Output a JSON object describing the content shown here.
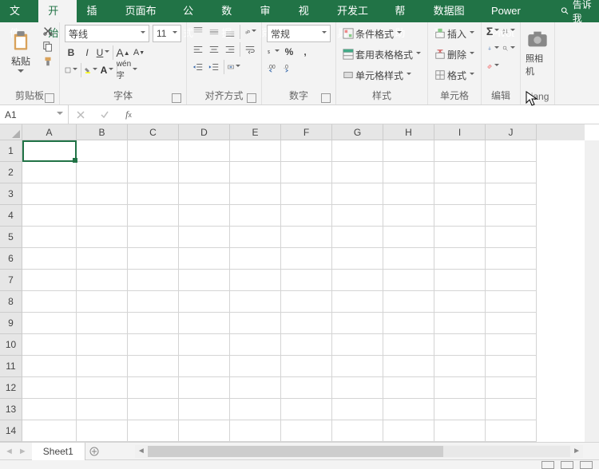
{
  "tabs": [
    "文件",
    "开始",
    "插入",
    "页面布局",
    "公式",
    "数据",
    "审阅",
    "视图",
    "开发工具",
    "帮助",
    "数据图表",
    "Power Pivot"
  ],
  "active_tab": 1,
  "tellme": "告诉我",
  "clipboard": {
    "paste": "粘贴",
    "label": "剪贴板"
  },
  "font": {
    "name": "等线",
    "size": "11",
    "label": "字体"
  },
  "align": {
    "label": "对齐方式"
  },
  "number": {
    "format": "常规",
    "label": "数字"
  },
  "styles": {
    "cond": "条件格式",
    "table": "套用表格格式",
    "cell": "单元格样式",
    "label": "样式"
  },
  "cells_grp": {
    "insert": "插入",
    "delete": "删除",
    "format": "格式",
    "label": "单元格"
  },
  "edit": {
    "label": "编辑"
  },
  "camera_grp": {
    "label": "照相机",
    "extra": "xiang"
  },
  "namebox": "A1",
  "columns": [
    "A",
    "B",
    "C",
    "D",
    "E",
    "F",
    "G",
    "H",
    "I",
    "J"
  ],
  "rows": [
    "1",
    "2",
    "3",
    "4",
    "5",
    "6",
    "7",
    "8",
    "9",
    "10",
    "11",
    "12",
    "13",
    "14"
  ],
  "sheet": "Sheet1"
}
